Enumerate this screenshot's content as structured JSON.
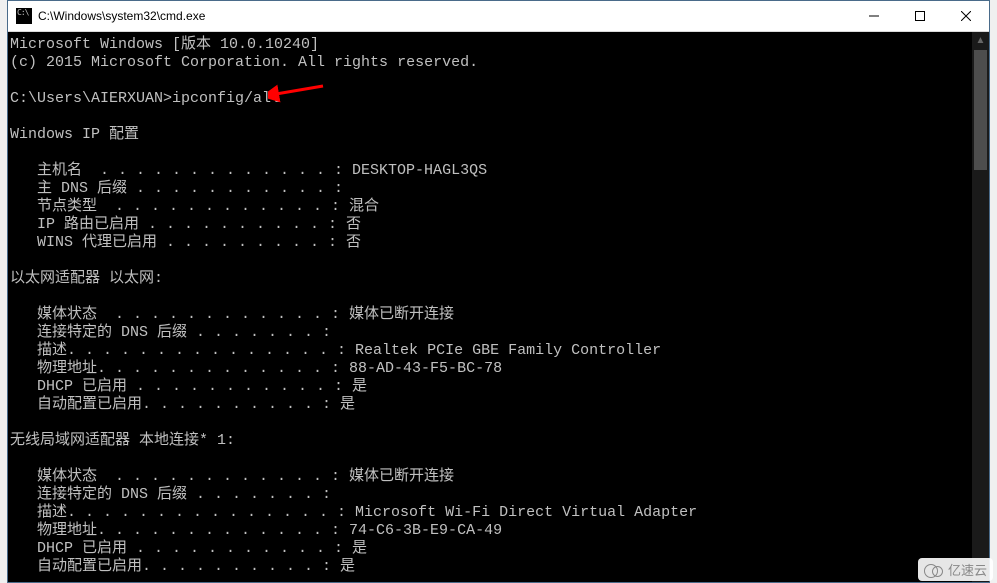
{
  "window": {
    "title": "C:\\Windows\\system32\\cmd.exe"
  },
  "terminal": {
    "lines": [
      "Microsoft Windows [版本 10.0.10240]",
      "(c) 2015 Microsoft Corporation. All rights reserved.",
      "",
      "C:\\Users\\AIERXUAN>ipconfig/all",
      "",
      "Windows IP 配置",
      "",
      "   主机名  . . . . . . . . . . . . . : DESKTOP-HAGL3QS",
      "   主 DNS 后缀 . . . . . . . . . . . :",
      "   节点类型  . . . . . . . . . . . . : 混合",
      "   IP 路由已启用 . . . . . . . . . . : 否",
      "   WINS 代理已启用 . . . . . . . . . : 否",
      "",
      "以太网适配器 以太网:",
      "",
      "   媒体状态  . . . . . . . . . . . . : 媒体已断开连接",
      "   连接特定的 DNS 后缀 . . . . . . . :",
      "   描述. . . . . . . . . . . . . . . : Realtek PCIe GBE Family Controller",
      "   物理地址. . . . . . . . . . . . . : 88-AD-43-F5-BC-78",
      "   DHCP 已启用 . . . . . . . . . . . : 是",
      "   自动配置已启用. . . . . . . . . . : 是",
      "",
      "无线局域网适配器 本地连接* 1:",
      "",
      "   媒体状态  . . . . . . . . . . . . : 媒体已断开连接",
      "   连接特定的 DNS 后缀 . . . . . . . :",
      "   描述. . . . . . . . . . . . . . . : Microsoft Wi-Fi Direct Virtual Adapter",
      "   物理地址. . . . . . . . . . . . . : 74-C6-3B-E9-CA-49",
      "   DHCP 已启用 . . . . . . . . . . . : 是",
      "   自动配置已启用. . . . . . . . . . : 是"
    ],
    "prompt_line_index": 3,
    "command": "ipconfig/all"
  },
  "annotation": {
    "arrow_color": "#ff0000",
    "points_to": "command"
  },
  "watermark": {
    "text": "亿速云"
  }
}
